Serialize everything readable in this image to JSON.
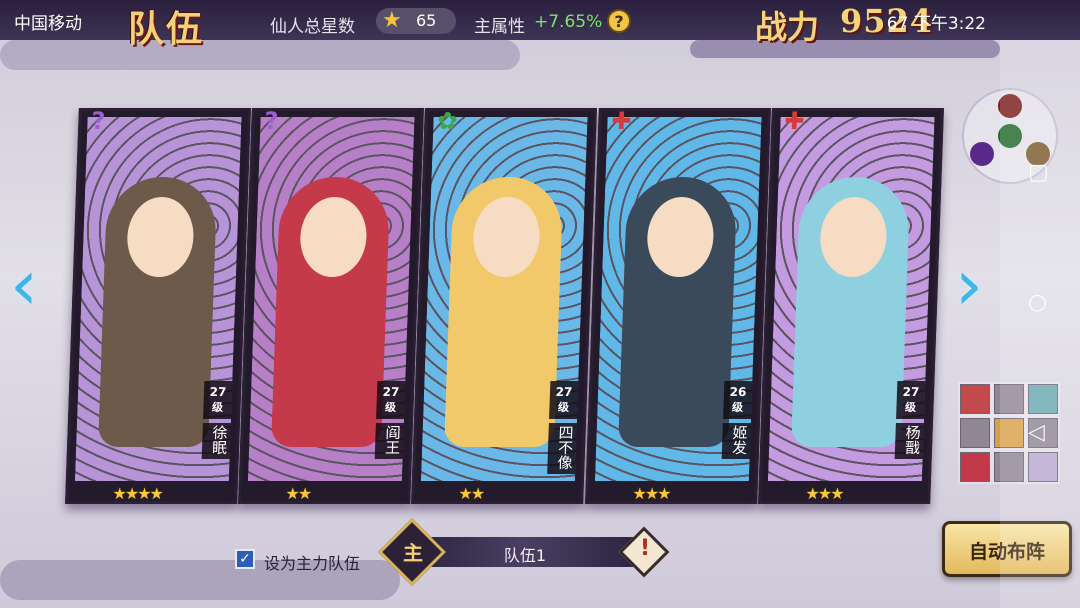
{
  "status_bar": {
    "carrier": "中国移动",
    "right_text": "67 下午3:22"
  },
  "header": {
    "team_logo": "队伍",
    "stars_label": "仙人总星数",
    "stars_value": "65",
    "attr_label": "主属性",
    "attr_value": "+7.65%",
    "help_icon": "?",
    "power_label": "战力",
    "power_value": "9524"
  },
  "cards": [
    {
      "level": "27",
      "unit": "级",
      "name": "徐眠",
      "stars": "★★★★",
      "class_icon": "?",
      "bg": "#b794d8",
      "char": "#6d5a4a",
      "class_color": "#9b5fd0"
    },
    {
      "level": "27",
      "unit": "级",
      "name": "阎王",
      "stars": "★★",
      "class_icon": "?",
      "bg": "#b77fc8",
      "char": "#c43a4a",
      "class_color": "#9b5fd0"
    },
    {
      "level": "27",
      "unit": "级",
      "name": "四不像",
      "stars": "★★",
      "class_icon": "✿",
      "bg": "#69b8e8",
      "char": "#f2c96a",
      "class_color": "#3aa84a"
    },
    {
      "level": "26",
      "unit": "级",
      "name": "姬发",
      "stars": "★★★",
      "class_icon": "✚",
      "bg": "#5fb8e8",
      "char": "#3a4a5a",
      "class_color": "#d83a3a"
    },
    {
      "level": "27",
      "unit": "级",
      "name": "杨戬",
      "stars": "★★★",
      "class_icon": "✚",
      "bg": "#c49ae0",
      "char": "#8fd0e0",
      "class_color": "#d83a3a"
    }
  ],
  "bottom": {
    "main_team_label": "设为主力队伍",
    "team_name": "队伍1",
    "team_emblem": "主",
    "rename_icon": "!",
    "auto_button": "自动布阵"
  },
  "colors": {
    "accent_gold": "#f3d47a",
    "arrow_blue": "#3fb5e8",
    "attr_green": "#7ee36a"
  }
}
